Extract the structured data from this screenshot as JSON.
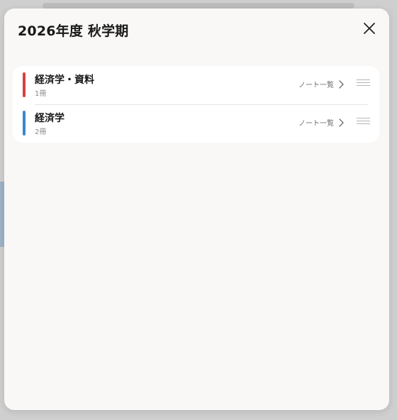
{
  "sheet": {
    "title": "2026年度 秋学期",
    "close_icon": "close-icon"
  },
  "subjects": [
    {
      "name": "経済学・資料",
      "count": "1冊",
      "color": "#d84040",
      "notes_link": "ノート一覧"
    },
    {
      "name": "経済学",
      "count": "2冊",
      "color": "#3a86d0",
      "notes_link": "ノート一覧"
    }
  ],
  "icons": {
    "chevron": "chevron-right-icon",
    "drag": "drag-handle-icon"
  }
}
